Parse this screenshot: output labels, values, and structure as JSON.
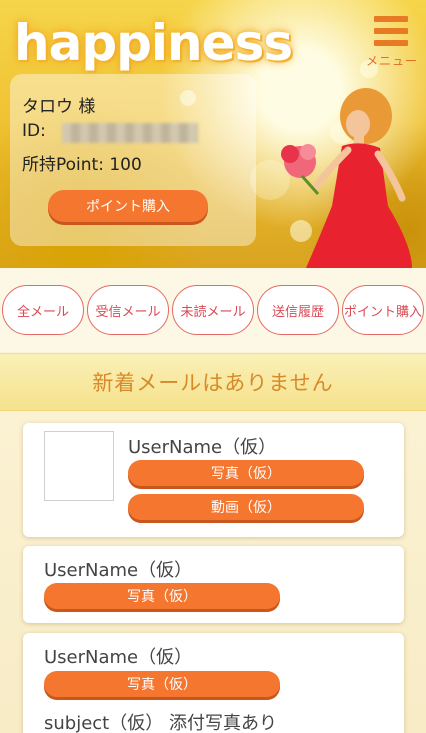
{
  "header": {
    "logo_text": "happiness",
    "menu_label": "メニュー",
    "menu_icon": "hamburger-icon",
    "accent_color": "#e87a25"
  },
  "user": {
    "name": "タロウ 様",
    "id_label": "ID:",
    "point_label": "所持Point: 100",
    "buy_button": "ポイント購入"
  },
  "tabs": [
    "全メール",
    "受信メール",
    "未読メール",
    "送信履歴",
    "ポイント購入"
  ],
  "notice": "新着メールはありません",
  "messages": [
    {
      "username": "UserName（仮）",
      "photo_button": "写真（仮）",
      "video_button": "動画（仮）"
    },
    {
      "username": "UserName（仮）",
      "photo_button": "写真（仮）"
    },
    {
      "username": "UserName（仮）",
      "photo_button": "写真（仮）",
      "subject": "subject（仮） 添付写真あり"
    }
  ],
  "colors": {
    "button_orange": "#f4762f",
    "tab_border": "#e46a63",
    "notice_text": "#d88a2a"
  }
}
